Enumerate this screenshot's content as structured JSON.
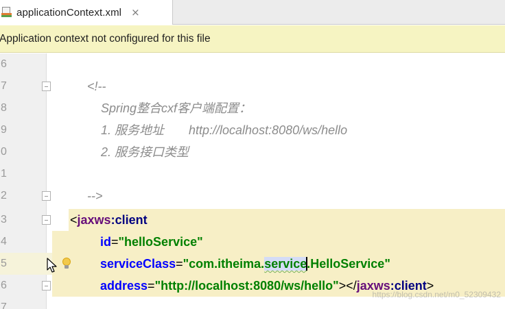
{
  "tab": {
    "title": "applicationContext.xml",
    "close": "×"
  },
  "banner": {
    "text": "Application context not configured for this file"
  },
  "editor": {
    "line_numbers": [
      "6",
      "7",
      "8",
      "9",
      "0",
      "1",
      "2",
      "3",
      "4",
      "5",
      "6",
      "7"
    ],
    "comment_open": "<!--",
    "comment_line1": "Spring整合cxf客户端配置：",
    "comment_line2_a": "1. 服务地址",
    "comment_line2_b": "http://localhost:8080/ws/hello",
    "comment_line3": "2. 服务接口类型",
    "comment_close": "-->",
    "tag_open_bracket": "<",
    "tag_ns": "jaxws",
    "tag_colon": ":",
    "tag_name": "client",
    "attr_id": "id",
    "attr_id_value": "\"helloService\"",
    "attr_serviceclass": "serviceClass",
    "sc_value_prefix": "\"com.itheima.",
    "sc_value_selected": "service",
    "sc_value_suffix": ".HelloService\"",
    "attr_address": "address",
    "address_value": "\"http://localhost:8080/ws/hello\"",
    "tag_close_part1": "></",
    "tag_close_part2": ">",
    "equals": "="
  },
  "watermark": "https://blog.csdn.net/m0_52309432"
}
